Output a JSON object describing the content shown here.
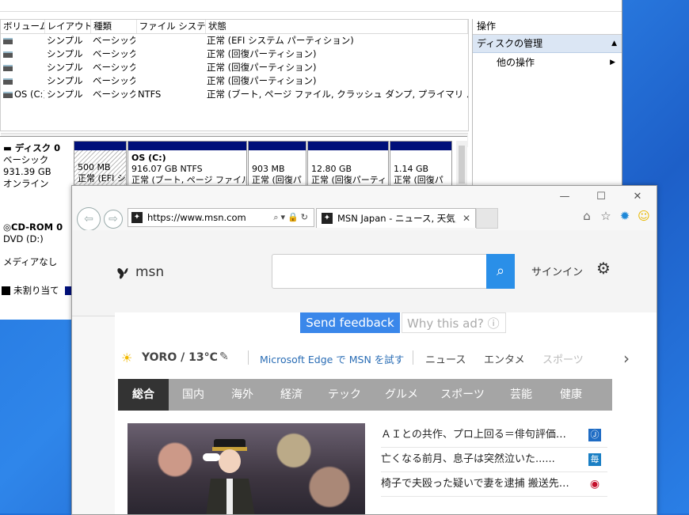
{
  "disk_mgmt": {
    "columns": [
      "ボリューム",
      "レイアウト",
      "種類",
      "ファイル システム",
      "状態"
    ],
    "rows": [
      {
        "volume": "",
        "layout": "シンプル",
        "type": "ベーシック",
        "fs": "",
        "status": "正常 (EFI システム パーティション)"
      },
      {
        "volume": "",
        "layout": "シンプル",
        "type": "ベーシック",
        "fs": "",
        "status": "正常 (回復パーティション)"
      },
      {
        "volume": "",
        "layout": "シンプル",
        "type": "ベーシック",
        "fs": "",
        "status": "正常 (回復パーティション)"
      },
      {
        "volume": "",
        "layout": "シンプル",
        "type": "ベーシック",
        "fs": "",
        "status": "正常 (回復パーティション)"
      },
      {
        "volume": "OS (C:)",
        "layout": "シンプル",
        "type": "ベーシック",
        "fs": "NTFS",
        "status": "正常 (ブート, ページ ファイル, クラッシュ ダンプ, プライマリ パーティション)"
      }
    ],
    "operations": {
      "title": "操作",
      "selected": "ディスクの管理",
      "item": "他の操作"
    },
    "disk0": {
      "name": "ディスク 0",
      "type": "ベーシック",
      "size": "931.39 GB",
      "state": "オンライン"
    },
    "cdrom0": {
      "name": "CD-ROM 0",
      "drive": "DVD (D:)",
      "media": "メディアなし"
    },
    "partitions": [
      {
        "size": "500 MB",
        "line2": "正常 (EFI シ"
      },
      {
        "name": "OS  (C:)",
        "size": "916.07 GB NTFS",
        "line2": "正常 (ブート, ページ ファイル, ク"
      },
      {
        "size": "903 MB",
        "line2": "正常 (回復パ"
      },
      {
        "size": "12.80 GB",
        "line2": "正常 (回復パーティ"
      },
      {
        "size": "1.14 GB",
        "line2": "正常 (回復パ"
      }
    ],
    "legend": "未割り当て"
  },
  "ie": {
    "url": "https://www.msn.com/ja-jp/?ocid=iehp",
    "tab_title": "MSN Japan - ニュース, 天気, メール",
    "favicon": "✦",
    "window_buttons": {
      "minimize": "—",
      "maximize": "☐",
      "close": "✕"
    }
  },
  "msn": {
    "logo": "msn",
    "search_placeholder": "",
    "signin": "サインイン",
    "feedback": "Send feedback",
    "why_ad": "Why this ad? ⓘ",
    "location": "YORO / 13°C",
    "edge_promo": "Microsoft Edge で MSN を試す",
    "topnav": [
      "ニュース",
      "エンタメ",
      "スポーツ"
    ],
    "categories": [
      "総合",
      "国内",
      "海外",
      "経済",
      "テック",
      "グルメ",
      "スポーツ",
      "芸能",
      "健康"
    ],
    "news": [
      {
        "text": "ＡＩとの共作、プロ上回る＝俳句評価…",
        "src_color": "#1f6cc4"
      },
      {
        "text": "亡くなる前月、息子は突然泣いた......",
        "src_color": "#1a7fc4"
      },
      {
        "text": "椅子で夫殴った疑いで妻を逮捕 搬送先…",
        "src_color": "#c4102c"
      }
    ]
  }
}
